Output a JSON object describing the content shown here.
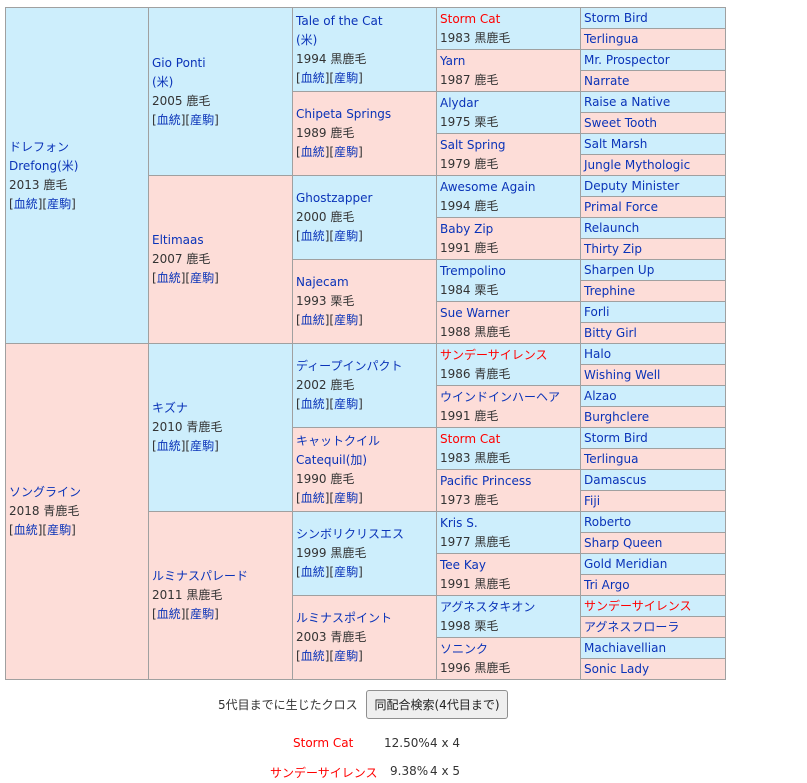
{
  "links": {
    "pedigree": "血統",
    "offspring": "産駒"
  },
  "gen1": [
    {
      "name": "ドレフォン",
      "name2": "Drefong(米)",
      "info": "2013 鹿毛"
    },
    {
      "name": "ソングライン",
      "info": "2018 青鹿毛"
    }
  ],
  "gen2": [
    {
      "name": "Gio Ponti",
      "name2": "(米)",
      "info": "2005 鹿毛"
    },
    {
      "name": "Eltimaas",
      "info": "2007 鹿毛"
    },
    {
      "name": "キズナ",
      "info": "2010 青鹿毛"
    },
    {
      "name": "ルミナスパレード",
      "info": "2011 黒鹿毛"
    }
  ],
  "gen3": [
    {
      "name": "Tale of the Cat",
      "name2": "(米)",
      "info": "1994 黒鹿毛"
    },
    {
      "name": "Chipeta Springs",
      "info": "1989 鹿毛"
    },
    {
      "name": "Ghostzapper",
      "info": "2000 鹿毛"
    },
    {
      "name": "Najecam",
      "info": "1993 栗毛"
    },
    {
      "name": "ディープインパクト",
      "info": "2002 鹿毛"
    },
    {
      "name": "キャットクイル",
      "name2": "Catequil(加)",
      "info": "1990 鹿毛"
    },
    {
      "name": "シンボリクリスエス",
      "info": "1999 黒鹿毛"
    },
    {
      "name": "ルミナスポイント",
      "info": "2003 青鹿毛"
    }
  ],
  "gen4": [
    {
      "name": "Storm Cat",
      "info": "1983 黒鹿毛",
      "red": true
    },
    {
      "name": "Yarn",
      "info": "1987 鹿毛"
    },
    {
      "name": "Alydar",
      "info": "1975 栗毛"
    },
    {
      "name": "Salt Spring",
      "info": "1979 鹿毛"
    },
    {
      "name": "Awesome Again",
      "info": "1994 鹿毛"
    },
    {
      "name": "Baby Zip",
      "info": "1991 鹿毛"
    },
    {
      "name": "Trempolino",
      "info": "1984 栗毛"
    },
    {
      "name": "Sue Warner",
      "info": "1988 黒鹿毛"
    },
    {
      "name": "サンデーサイレンス",
      "info": "1986 青鹿毛",
      "red": true
    },
    {
      "name": "ウインドインハーヘア",
      "info": "1991 鹿毛"
    },
    {
      "name": "Storm Cat",
      "info": "1983 黒鹿毛",
      "red": true
    },
    {
      "name": "Pacific Princess",
      "info": "1973 鹿毛"
    },
    {
      "name": "Kris S.",
      "info": "1977 黒鹿毛"
    },
    {
      "name": "Tee Kay",
      "info": "1991 黒鹿毛"
    },
    {
      "name": "アグネスタキオン",
      "info": "1998 栗毛"
    },
    {
      "name": "ソニンク",
      "info": "1996 黒鹿毛"
    }
  ],
  "gen5": [
    {
      "name": "Storm Bird"
    },
    {
      "name": "Terlingua"
    },
    {
      "name": "Mr. Prospector"
    },
    {
      "name": "Narrate"
    },
    {
      "name": "Raise a Native"
    },
    {
      "name": "Sweet Tooth"
    },
    {
      "name": "Salt Marsh"
    },
    {
      "name": "Jungle Mythologic"
    },
    {
      "name": "Deputy Minister"
    },
    {
      "name": "Primal Force"
    },
    {
      "name": "Relaunch"
    },
    {
      "name": "Thirty Zip"
    },
    {
      "name": "Sharpen Up"
    },
    {
      "name": "Trephine"
    },
    {
      "name": "Forli"
    },
    {
      "name": "Bitty Girl"
    },
    {
      "name": "Halo"
    },
    {
      "name": "Wishing Well"
    },
    {
      "name": "Alzao"
    },
    {
      "name": "Burghclere"
    },
    {
      "name": "Storm Bird"
    },
    {
      "name": "Terlingua"
    },
    {
      "name": "Damascus"
    },
    {
      "name": "Fiji"
    },
    {
      "name": "Roberto"
    },
    {
      "name": "Sharp Queen"
    },
    {
      "name": "Gold Meridian"
    },
    {
      "name": "Tri Argo"
    },
    {
      "name": "サンデーサイレンス",
      "red": true
    },
    {
      "name": "アグネスフローラ"
    },
    {
      "name": "Machiavellian"
    },
    {
      "name": "Sonic Lady"
    }
  ],
  "cross": {
    "label": "5代目までに生じたクロス",
    "button": "同配合検索(4代目まで)",
    "rows": [
      {
        "name": "Storm Cat",
        "pct": "12.50%",
        "gen": "4 x 4"
      },
      {
        "name": "サンデーサイレンス",
        "pct": "9.38%",
        "gen": "4 x 5"
      }
    ]
  },
  "colors": {
    "sire_bg": "#cdeefc",
    "dam_bg": "#fddcd8",
    "link": "#0a33b8",
    "cross_highlight": "#ff0000"
  }
}
